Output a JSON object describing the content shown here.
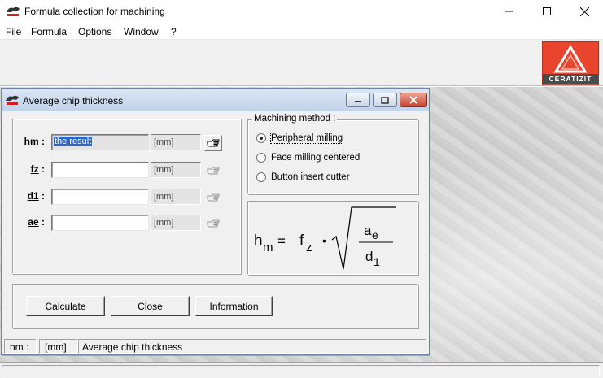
{
  "app": {
    "title": "Formula collection for machining",
    "icon": "app-logo-icon",
    "brand": "CERATIZIT",
    "brand_color": "#e8442e"
  },
  "menu": [
    "File",
    "Formula",
    "Options",
    "Window",
    "?"
  ],
  "dialog": {
    "title": "Average chip thickness",
    "fields": [
      {
        "label": "hm",
        "value": "the result",
        "unit": "[mm]"
      },
      {
        "label": "fz",
        "value": "",
        "unit": "[mm]"
      },
      {
        "label": "d1",
        "value": "",
        "unit": "[mm]"
      },
      {
        "label": "ae",
        "value": "",
        "unit": "[mm]"
      }
    ],
    "method": {
      "legend": "Machining method :",
      "options": [
        {
          "label": "Peripheral milling",
          "selected": true
        },
        {
          "label": "Face milling centered",
          "selected": false
        },
        {
          "label": "Button insert cutter",
          "selected": false
        }
      ]
    },
    "formula": {
      "lhs": "h",
      "lhs_sub": "m",
      "eq": "=",
      "f": "f",
      "f_sub": "z",
      "dot": "•",
      "num": "a",
      "num_sub": "e",
      "den": "d",
      "den_sub": "1"
    },
    "buttons": {
      "calculate": "Calculate",
      "close": "Close",
      "information": "Information"
    },
    "status": {
      "field": "hm :",
      "unit": "[mm]",
      "description": "Average chip thickness"
    }
  }
}
